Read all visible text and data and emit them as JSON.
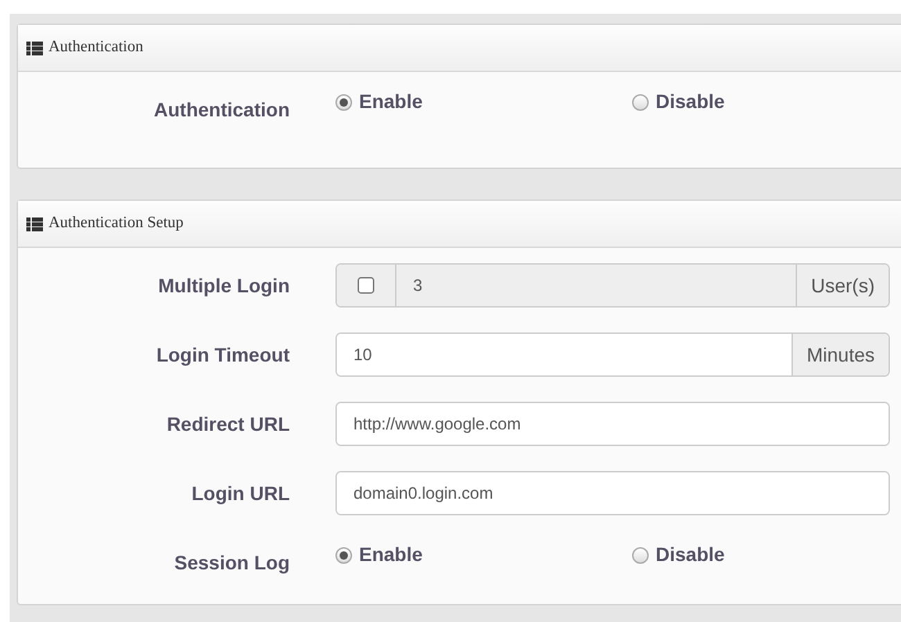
{
  "sections": [
    {
      "title": "Authentication",
      "rows": [
        {
          "kind": "radio",
          "label": "Authentication",
          "options": [
            {
              "label": "Enable",
              "selected": true
            },
            {
              "label": "Disable",
              "selected": false
            }
          ]
        }
      ]
    },
    {
      "title": "Authentication Setup",
      "rows": [
        {
          "kind": "check-addon",
          "label": "Multiple Login",
          "checked": false,
          "disabled": true,
          "value": "3",
          "addon": "User(s)"
        },
        {
          "kind": "addon",
          "label": "Login Timeout",
          "disabled": false,
          "value": "10",
          "addon": "Minutes"
        },
        {
          "kind": "text",
          "label": "Redirect URL",
          "value": "http://www.google.com"
        },
        {
          "kind": "text",
          "label": "Login URL",
          "value": "domain0.login.com"
        },
        {
          "kind": "radio",
          "label": "Session Log",
          "options": [
            {
              "label": "Enable",
              "selected": true
            },
            {
              "label": "Disable",
              "selected": false
            }
          ]
        }
      ]
    }
  ]
}
